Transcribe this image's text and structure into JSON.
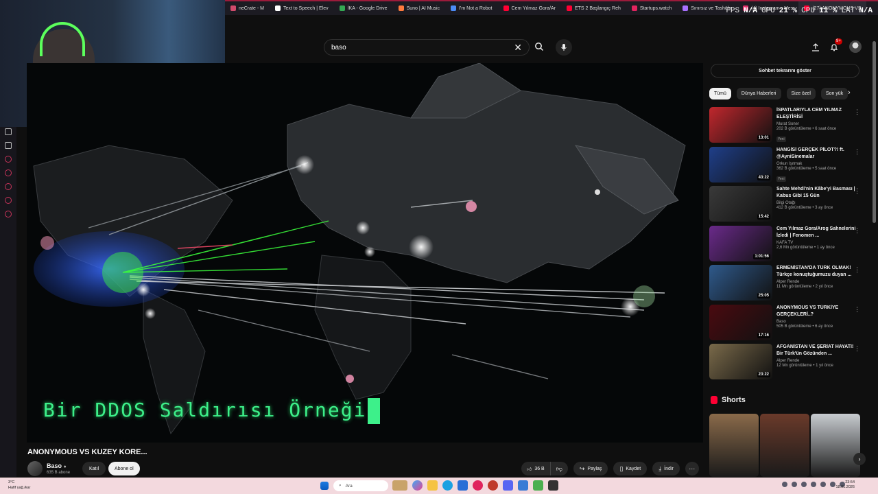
{
  "browser": {
    "tabs": [
      {
        "label": "neCrate - M",
        "color": "#d14b6c"
      },
      {
        "label": "Text to Speech | Elev",
        "color": "#ffffff"
      },
      {
        "label": "İKA - Google Drive",
        "color": "#34a853"
      },
      {
        "label": "Suno | AI Music",
        "color": "#ff7a3d"
      },
      {
        "label": "I'm Not a Robot",
        "color": "#4c8bf5"
      },
      {
        "label": "Cem Yılmaz Gora/Ar",
        "color": "#ff0033"
      },
      {
        "label": "ETS 2 Başlangıç Reh",
        "color": "#ff0033"
      },
      {
        "label": "Startups.watch",
        "color": "#e0245e"
      },
      {
        "label": "Sınırsız ve Tashöhr",
        "color": "#a970ff"
      },
      {
        "label": "(4) Instagram • Mes",
        "color": "#e1306c"
      },
      {
        "label": "(27) ANONYMOUS VS",
        "color": "#ff0033"
      }
    ],
    "perf": {
      "fps_label": "FPS",
      "fps_value": "N/A",
      "gpu_label": "GPU",
      "gpu_value": "21 %",
      "cpu_label": "CPU",
      "cpu_value": "11 %",
      "lat_label": "LAT",
      "lat_value": "N/A"
    }
  },
  "header": {
    "search_value": "baso",
    "notif_badge": "9+"
  },
  "video": {
    "overlay_text": "Bir DDOS Saldırısı Örneği",
    "title": "ANONYMOUS VS KUZEY KORE...",
    "channel_name": "Baso",
    "channel_subs": "635 B abone",
    "join_label": "Katıl",
    "subscribe_label": "Abone ol",
    "like_count": "36 B",
    "share_label": "Paylaş",
    "save_label": "Kaydet",
    "download_label": "İndir"
  },
  "sidebar": {
    "chat_label": "Sohbet tekrarını göster",
    "chips": [
      "Tümü",
      "Dünya Haberleri",
      "Size özel",
      "Son yük"
    ],
    "recs": [
      {
        "title": "İSPATLARIYLA CEM YILMAZ ELEŞTİRİSİ",
        "channel": "Murat Soner",
        "views": "202 B görüntüleme • 6 saat önce",
        "badge": "Yeni",
        "duration": "13:01",
        "thumb": "#c1272d"
      },
      {
        "title": "HANGİSİ GERÇEK PİLOT?! ft. @AyniSinemalar",
        "channel": "Orkun Işıtmak",
        "views": "362 B görüntüleme • 5 saat önce",
        "badge": "Yeni",
        "duration": "43:22",
        "thumb": "#1f3f8a"
      },
      {
        "title": "Sahte Mehdi'nin Kâbe'yi Basması | Kabus Gibi 15 Gün",
        "channel": "Bilgi Otağı",
        "views": "412 B görüntüleme • 3 ay önce",
        "badge": "",
        "duration": "15:42",
        "thumb": "#3a3a3a"
      },
      {
        "title": "Cem Yılmaz Gora/Arog Sahnelerini İzledi | Fenomen ...",
        "channel": "KAFA TV",
        "views": "2,6 Mn görüntüleme • 1 ay önce",
        "badge": "",
        "duration": "1:01:56",
        "thumb": "#6a2a8a"
      },
      {
        "title": "ERMENİSTAN'DA TÜRK OLMAK! Türkçe konuştuğumuzu duyan ...",
        "channel": "Alper Rende",
        "views": "11 Mn görüntüleme • 2 yıl önce",
        "badge": "",
        "duration": "25:05",
        "thumb": "#2f5a8c"
      },
      {
        "title": "ANONYMOUS VS TÜRKİYE GERÇEKLERİ..?",
        "channel": "Baso",
        "views": "505 B görüntüleme • 6 ay önce",
        "badge": "",
        "duration": "17:16",
        "thumb": "#4a0a10"
      },
      {
        "title": "AFGANİSTAN VE ŞERİAT HAYATI! Bir Türk'ün Gözünden ...",
        "channel": "Alper Rende",
        "views": "12 Mn görüntüleme • 1 yıl önce",
        "badge": "",
        "duration": "23:22",
        "thumb": "#7a6a4a"
      }
    ],
    "shorts_label": "Shorts",
    "shorts": [
      {
        "color": "#8a6a4a"
      },
      {
        "color": "#6a3a2a"
      },
      {
        "color": "#c8ccd0"
      }
    ]
  },
  "taskbar": {
    "weather_temp": "3°C",
    "weather_desc": "Hafif yağ./kar",
    "search_label": "Ara",
    "time": "23:54",
    "date": "18.01.2026"
  }
}
